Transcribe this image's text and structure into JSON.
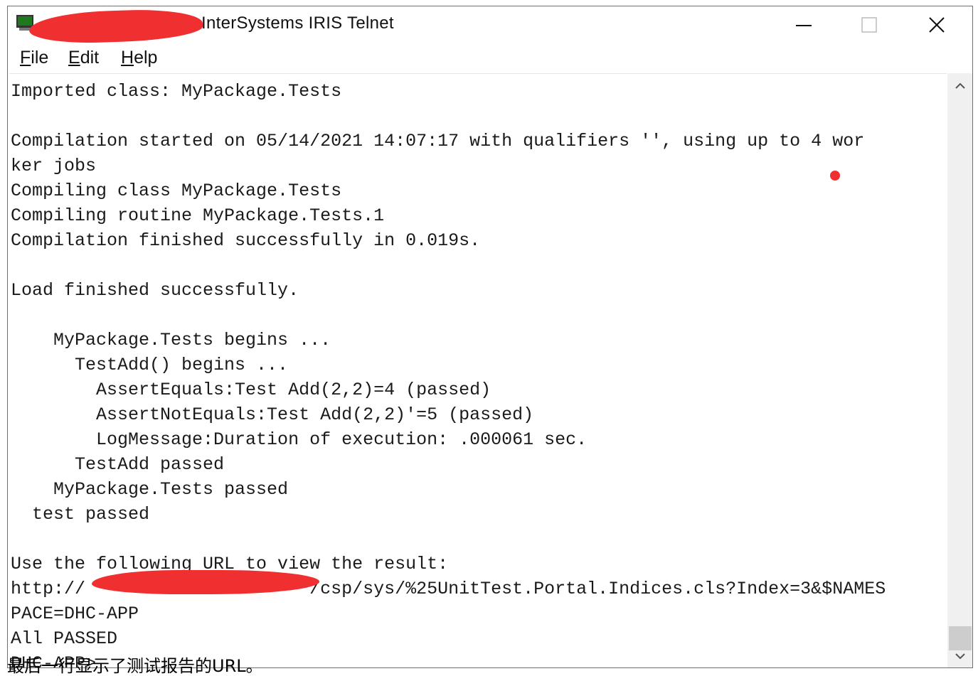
{
  "window": {
    "title": "InterSystems IRIS Telnet",
    "controls": {
      "minimize_icon": "minimize-icon",
      "maximize_icon": "maximize-icon",
      "close_icon": "close-icon"
    }
  },
  "menu": [
    {
      "label": "File"
    },
    {
      "label": "Edit"
    },
    {
      "label": "Help"
    }
  ],
  "console": {
    "lines": [
      "Imported class: MyPackage.Tests",
      "",
      "Compilation started on 05/14/2021 14:07:17 with qualifiers '', using up to 4 wor",
      "ker jobs",
      "Compiling class MyPackage.Tests",
      "Compiling routine MyPackage.Tests.1",
      "Compilation finished successfully in 0.019s.",
      "",
      "Load finished successfully.",
      "",
      "    MyPackage.Tests begins ...",
      "      TestAdd() begins ...",
      "        AssertEquals:Test Add(2,2)=4 (passed)",
      "        AssertNotEquals:Test Add(2,2)'=5 (passed)",
      "        LogMessage:Duration of execution: .000061 sec.",
      "      TestAdd passed",
      "    MyPackage.Tests passed",
      "  test passed",
      "",
      "Use the following URL to view the result:",
      "http://                     /csp/sys/%25UnitTest.Portal.Indices.cls?Index=3&$NAMES",
      "PACE=DHC-APP",
      "All PASSED",
      "DHC-APP>"
    ]
  },
  "caption": "最后一行显示了测试报告的URL。",
  "colors": {
    "redaction": "#f03030",
    "text": "#1a1a1a",
    "scrollbar": "#f0f0f0"
  }
}
